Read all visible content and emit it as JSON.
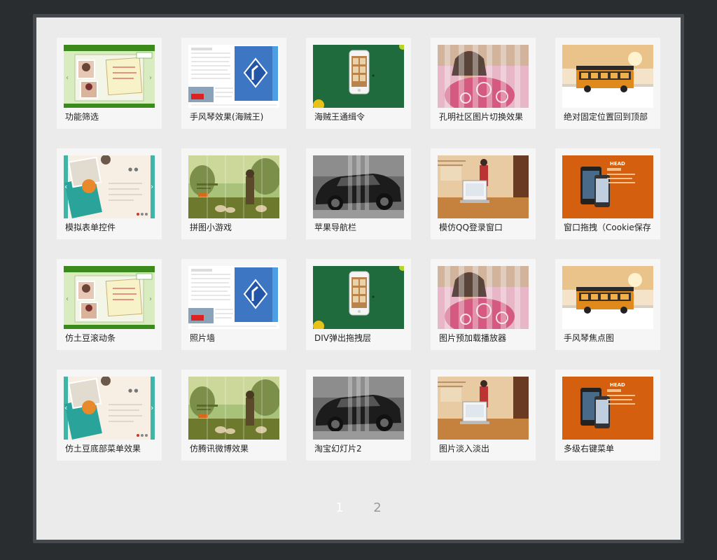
{
  "gallery": {
    "items": [
      {
        "title": "功能筛选",
        "thumb": "green-book"
      },
      {
        "title": "手风琴效果(海贼王)",
        "thumb": "road-sign"
      },
      {
        "title": "海贼王通缉令",
        "thumb": "phone-green"
      },
      {
        "title": "孔明社区图片切换效果",
        "thumb": "portrait-blend"
      },
      {
        "title": "绝对固定位置回到顶部",
        "thumb": "bus-sunset"
      },
      {
        "title": "模拟表单控件",
        "thumb": "teal-book"
      },
      {
        "title": "拼图小游戏",
        "thumb": "forest-scene"
      },
      {
        "title": "苹果导航栏",
        "thumb": "black-car"
      },
      {
        "title": "模仿QQ登录窗口",
        "thumb": "office-laptop"
      },
      {
        "title": "窗口拖拽（Cookie保存",
        "thumb": "orange-devices"
      },
      {
        "title": "仿土豆滚动条",
        "thumb": "green-book"
      },
      {
        "title": "照片墙",
        "thumb": "road-sign"
      },
      {
        "title": "DIV弹出拖拽层",
        "thumb": "phone-green"
      },
      {
        "title": "图片预加载播放器",
        "thumb": "portrait-blend"
      },
      {
        "title": "手风琴焦点图",
        "thumb": "bus-sunset"
      },
      {
        "title": "仿土豆底部菜单效果",
        "thumb": "teal-book"
      },
      {
        "title": "仿腾讯微博效果",
        "thumb": "forest-scene"
      },
      {
        "title": "淘宝幻灯片2",
        "thumb": "black-car"
      },
      {
        "title": "图片淡入淡出",
        "thumb": "office-laptop"
      },
      {
        "title": "多级右键菜单",
        "thumb": "orange-devices"
      }
    ]
  },
  "pagination": {
    "pages": [
      "1",
      "2"
    ],
    "current": "1"
  },
  "colors": {
    "background": "#2a2d30",
    "panel": "#ebebeb",
    "card": "#f6f6f6",
    "page_current": "#ffffff",
    "page_other": "#9a9a9a"
  }
}
